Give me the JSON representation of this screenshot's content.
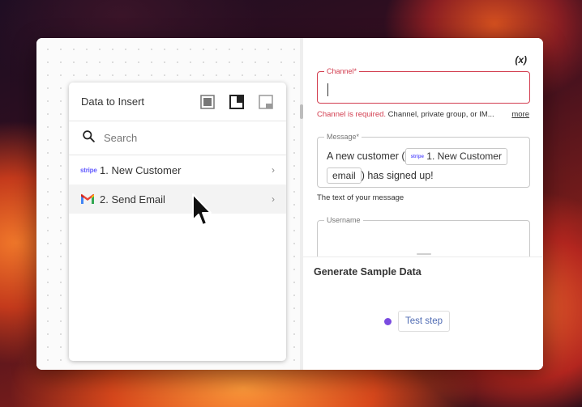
{
  "data_panel": {
    "title": "Data to Insert",
    "search_placeholder": "Search",
    "steps": [
      {
        "label": "1. New Customer",
        "app": "stripe",
        "logo_text": "stripe"
      },
      {
        "label": "2. Send Email",
        "app": "gmail"
      }
    ],
    "layout_icons": [
      "layout-full-icon",
      "layout-split-icon",
      "layout-corner-icon"
    ]
  },
  "form": {
    "variable_button": "(x)",
    "channel": {
      "label": "Channel*",
      "value": "",
      "error": "Channel is required.",
      "helper": "Channel, private group, or IM...",
      "more": "more"
    },
    "message": {
      "label": "Message*",
      "text_before": "A new customer (",
      "chip_logo": "stripe",
      "chip_part1": "1. New Customer",
      "chip_part2": "email",
      "text_after": ") has signed up!",
      "helper": "The text of your message"
    },
    "username": {
      "label": "Username",
      "value": ""
    }
  },
  "sample": {
    "title": "Generate Sample Data",
    "test_button": "Test step"
  },
  "colors": {
    "error": "#d23c4e",
    "stripe": "#635bff",
    "accent": "#7a4be0",
    "link": "#4f6bb3"
  }
}
